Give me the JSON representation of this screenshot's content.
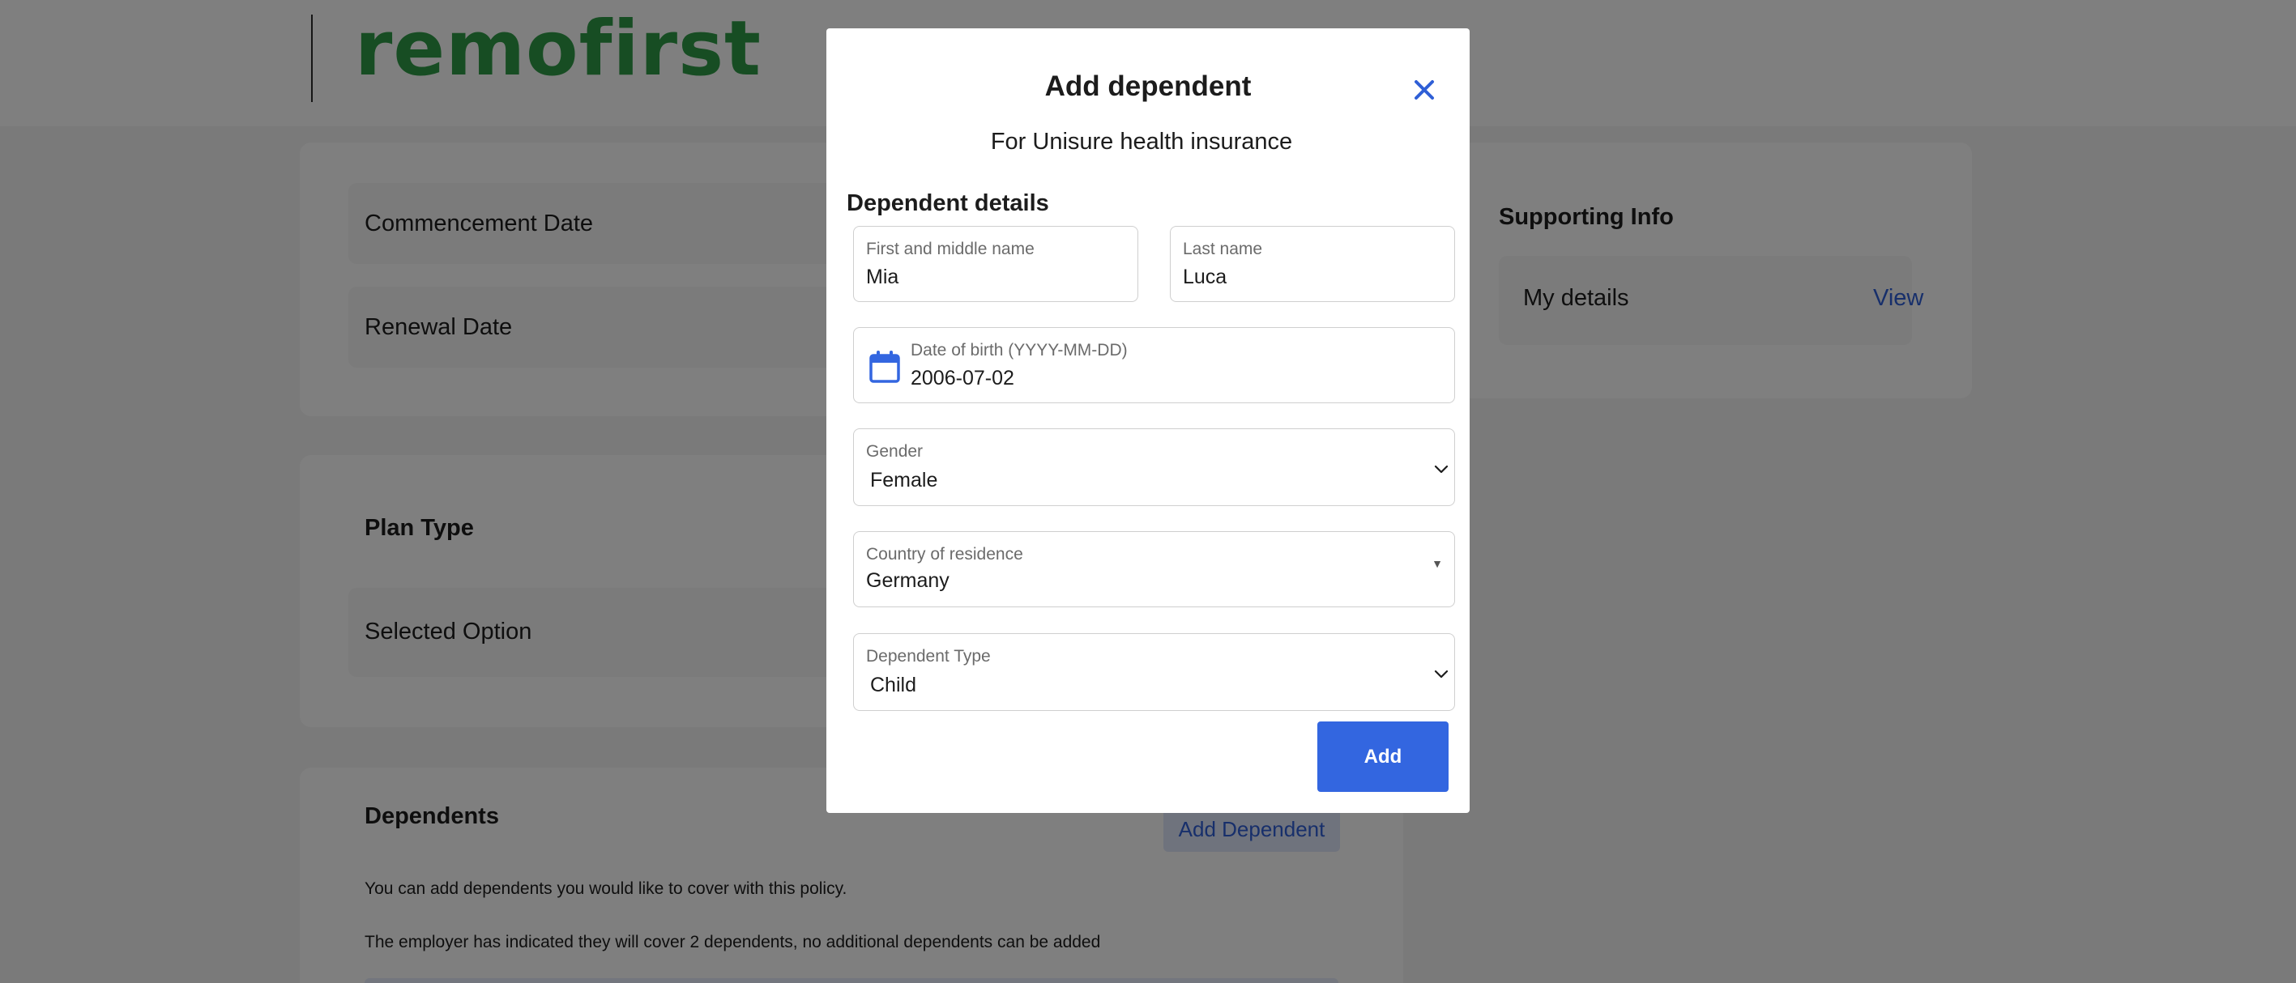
{
  "header": {
    "logo_text": "remofirst"
  },
  "policy_dates": {
    "commencement_label": "Commencement Date",
    "renewal_label": "Renewal Date"
  },
  "plan": {
    "title": "Plan Type",
    "selected_label": "Selected Option"
  },
  "dependents": {
    "title": "Dependents",
    "add_button": "Add Dependent",
    "info_1": "You can add dependents you would like to cover with this policy.",
    "info_2": "The employer has indicated they will cover 2 dependents, no additional dependents can be added"
  },
  "supporting": {
    "title": "Supporting Info",
    "my_details_label": "My details",
    "view_link": "View"
  },
  "modal": {
    "title": "Add dependent",
    "subtitle": "For Unisure health insurance",
    "section_heading": "Dependent details",
    "first_name": {
      "label": "First and middle name",
      "value": "Mia"
    },
    "last_name": {
      "label": "Last name",
      "value": "Luca"
    },
    "dob": {
      "label": "Date of birth (YYYY-MM-DD)",
      "value": "2006-07-02"
    },
    "gender": {
      "label": "Gender",
      "value": "Female"
    },
    "country": {
      "label": "Country of residence",
      "value": "Germany"
    },
    "dependent_type": {
      "label": "Dependent Type",
      "value": "Child"
    },
    "submit_label": "Add"
  },
  "colors": {
    "accent": "#3366e0",
    "brand_green": "#2e9b46",
    "link": "#2f5fd6",
    "overlay": "rgba(0,0,0,0.5)"
  },
  "icons": [
    "close-icon",
    "calendar-icon",
    "chevron-down-icon",
    "caret-down-icon"
  ]
}
